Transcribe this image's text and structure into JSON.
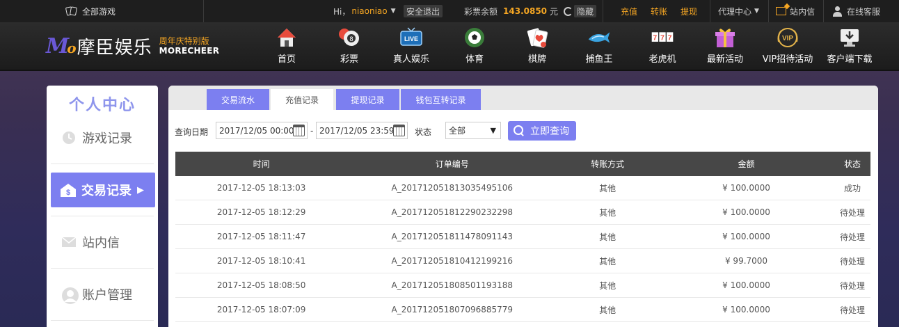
{
  "topbar": {
    "all_games": "全部游戏",
    "greeting": "Hi，",
    "username": "niaoniao",
    "logout": "安全退出",
    "balance_label": "彩票余额",
    "balance_value": "143.0850",
    "balance_unit": "元",
    "hide": "隐藏",
    "recharge": "充值",
    "transfer": "转账",
    "withdraw": "提现",
    "agent_center": "代理中心",
    "messages": "站内信",
    "online_service": "在线客服",
    "accent_color": "#f5a623"
  },
  "logo": {
    "mark": "Mo",
    "name": "摩臣娱乐",
    "anniversary": "周年庆特别版",
    "english": "MORECHEER"
  },
  "nav": {
    "items": [
      {
        "label": "首页",
        "icon": "home-icon"
      },
      {
        "label": "彩票",
        "icon": "lottery-balls-icon"
      },
      {
        "label": "真人娱乐",
        "icon": "live-tv-icon"
      },
      {
        "label": "体育",
        "icon": "football-icon"
      },
      {
        "label": "棋牌",
        "icon": "playing-cards-icon"
      },
      {
        "label": "捕鱼王",
        "icon": "fish-icon"
      },
      {
        "label": "老虎机",
        "icon": "slot-machine-icon"
      },
      {
        "label": "最新活动",
        "icon": "gift-box-icon"
      },
      {
        "label": "VIP招待活动",
        "icon": "vip-badge-icon"
      },
      {
        "label": "客户端下载",
        "icon": "download-monitor-icon"
      }
    ]
  },
  "sidebar": {
    "title": "个人中心",
    "items": [
      {
        "label": "游戏记录",
        "icon": "clock-icon"
      },
      {
        "label": "交易记录",
        "icon": "dollar-house-icon",
        "active": true
      },
      {
        "label": "站内信",
        "icon": "envelope-icon"
      },
      {
        "label": "账户管理",
        "icon": "user-avatar-icon"
      }
    ],
    "active_color": "#7c7ff0"
  },
  "tabs": [
    {
      "label": "交易流水",
      "active": false
    },
    {
      "label": "充值记录",
      "active": true
    },
    {
      "label": "提现记录",
      "active": false
    },
    {
      "label": "钱包互转记录",
      "active": false
    }
  ],
  "filter": {
    "date_label": "查询日期",
    "start_date": "2017/12/05 00:00",
    "end_date": "2017/12/05 23:59",
    "separator": "-",
    "status_label": "状态",
    "status_value": "全部",
    "query_button": "立即查询"
  },
  "table": {
    "headers": [
      "时间",
      "订单编号",
      "转账方式",
      "金额",
      "状态"
    ],
    "rows": [
      [
        "2017-12-05 18:13:03",
        "A_201712051813035495106",
        "其他",
        "¥ 100.0000",
        "成功"
      ],
      [
        "2017-12-05 18:12:29",
        "A_201712051812290232298",
        "其他",
        "¥ 100.0000",
        "待处理"
      ],
      [
        "2017-12-05 18:11:47",
        "A_201712051811478091143",
        "其他",
        "¥ 100.0000",
        "待处理"
      ],
      [
        "2017-12-05 18:10:41",
        "A_201712051810412199216",
        "其他",
        "¥ 99.7000",
        "待处理"
      ],
      [
        "2017-12-05 18:08:50",
        "A_201712051808501193188",
        "其他",
        "¥ 100.0000",
        "待处理"
      ],
      [
        "2017-12-05 18:07:09",
        "A_201712051807096885779",
        "其他",
        "¥ 100.0000",
        "待处理"
      ]
    ]
  }
}
